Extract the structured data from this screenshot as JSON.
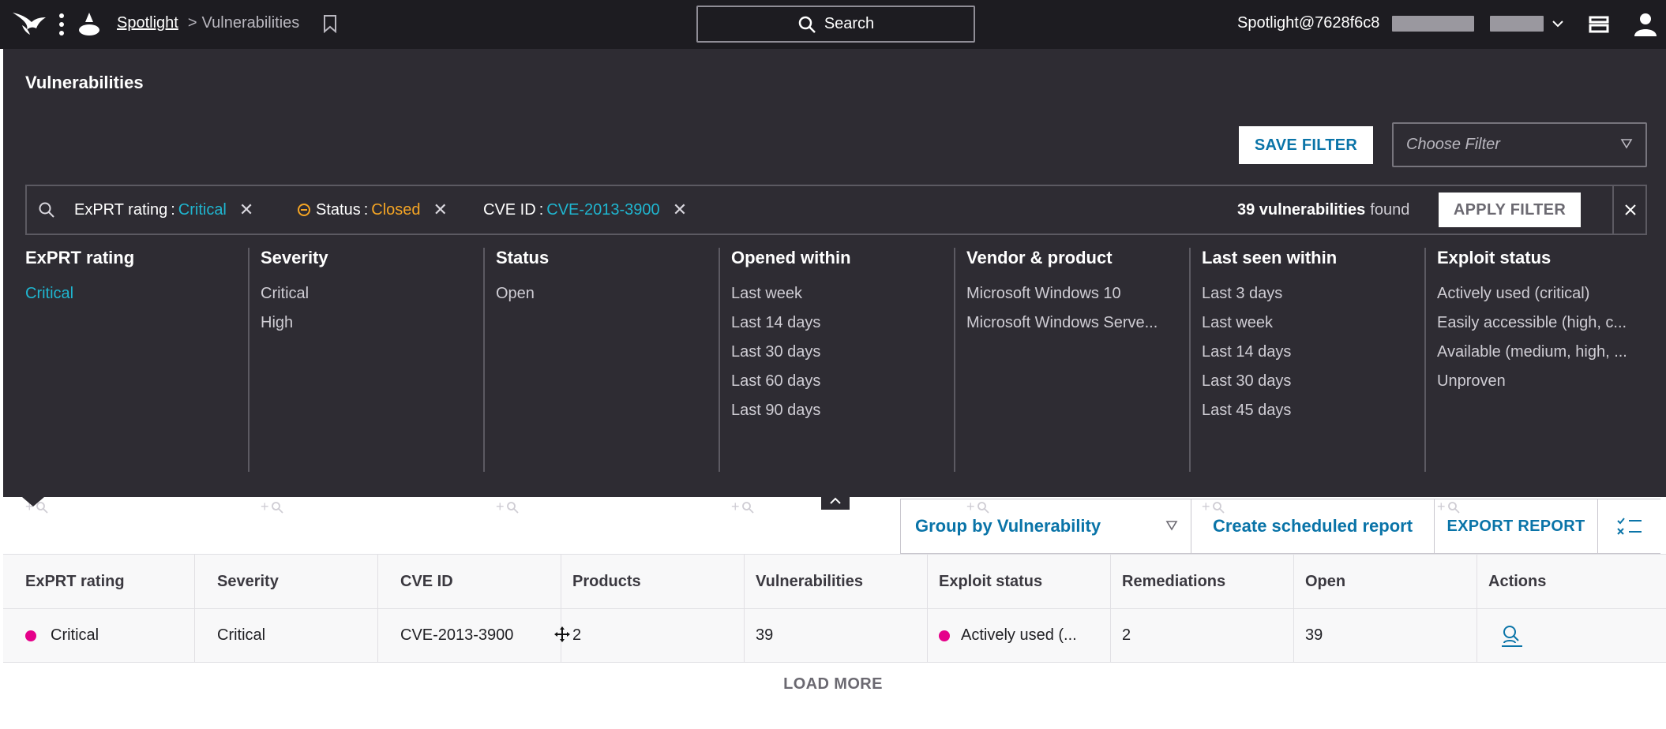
{
  "header": {
    "breadcrumb_root": "Spotlight",
    "breadcrumb_sep": ">",
    "breadcrumb_current": "Vulnerabilities",
    "search_label": "Search",
    "user": "Spotlight@7628f6c8"
  },
  "panel": {
    "title": "Vulnerabilities",
    "save_filter": "SAVE FILTER",
    "choose_filter_placeholder": "Choose Filter",
    "chips": [
      {
        "key": "ExPRT rating",
        "sep": ":",
        "value": "Critical"
      },
      {
        "key": "Status",
        "sep": ":",
        "value": "Closed"
      },
      {
        "key": "CVE ID",
        "sep": ":",
        "value": "CVE-2013-3900"
      }
    ],
    "found_count": "39 vulnerabilities",
    "found_suffix": "found",
    "apply_filter": "APPLY FILTER",
    "facets": [
      {
        "title": "ExPRT rating",
        "items": [
          "Critical"
        ],
        "selected": 0
      },
      {
        "title": "Severity",
        "items": [
          "Critical",
          "High"
        ]
      },
      {
        "title": "Status",
        "items": [
          "Open"
        ]
      },
      {
        "title": "Opened within",
        "items": [
          "Last week",
          "Last 14 days",
          "Last 30 days",
          "Last 60 days",
          "Last 90 days"
        ]
      },
      {
        "title": "Vendor & product",
        "items": [
          "Microsoft Windows 10",
          "Microsoft Windows Serve..."
        ]
      },
      {
        "title": "Last seen within",
        "items": [
          "Last 3 days",
          "Last week",
          "Last 14 days",
          "Last 30 days",
          "Last 45 days"
        ]
      },
      {
        "title": "Exploit status",
        "items": [
          "Actively used (critical)",
          "Easily accessible (high, c...",
          "Available (medium, high, ...",
          "Unproven"
        ]
      }
    ],
    "facet_more": "+"
  },
  "toolbar": {
    "group_by": "Group by Vulnerability",
    "create_scheduled": "Create scheduled report",
    "export": "EXPORT REPORT"
  },
  "table": {
    "columns": [
      "ExPRT rating",
      "Severity",
      "CVE ID",
      "Products",
      "Vulnerabilities",
      "Exploit status",
      "Remediations",
      "Open",
      "Actions"
    ],
    "rows": [
      {
        "exprt": "Critical",
        "severity": "Critical",
        "cve": "CVE-2013-3900",
        "products": "2",
        "vulns": "39",
        "exploit": "Actively used (...",
        "remediations": "2",
        "open": "39"
      }
    ],
    "load_more": "LOAD MORE"
  },
  "colors": {
    "accent_teal": "#1fb6d0",
    "accent_orange": "#f5a524",
    "link_blue": "#0a74a8",
    "critical_dot": "#e5008a"
  }
}
